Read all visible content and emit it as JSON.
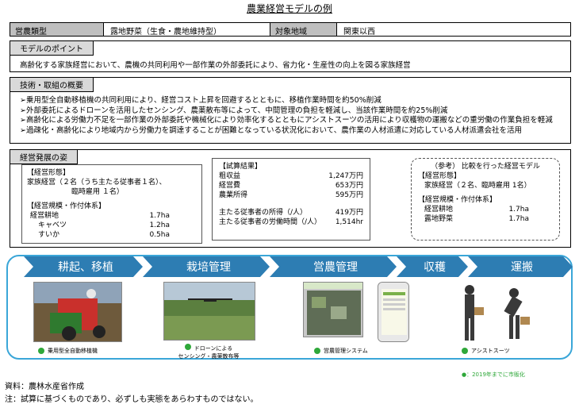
{
  "title": "農業経営モデルの例",
  "header": {
    "type_label": "営農類型",
    "type_value": "露地野菜（生食・農地維持型）",
    "area_label": "対象地域",
    "area_value": "関東以西"
  },
  "point": {
    "label": "モデルのポイント",
    "text": "高齢化する家族経営において、農機の共同利用や一部作業の外部委託により、省力化・生産性の向上を図る家族経営"
  },
  "tech": {
    "label": "技術・取組の概要",
    "items": [
      "➢乗用型全自動移植機の共同利用により、経営コスト上昇を回避するとともに、移植作業時間を約50%削減",
      "➢外部委託によるドローンを活用したセンシング、農薬散布等によって、中間管理の負担を軽減し、当該作業時間を約25%削減",
      "➢高齢化による労働力不足を一部作業の外部委託や機械化により効率化するとともにアシストスーツの活用により収穫物の運搬などの重労働の作業負担を軽減",
      "➢過疎化・高齢化により地域内から労働力を調達することが困難となっている状況化において、農作業の人材派遣に対応している人材派遣会社を活用"
    ]
  },
  "dev": {
    "label": "経営発展の姿",
    "form_header": "【経営形態】",
    "form_line1": "家族経営（２名（うち主たる従事者１名）、",
    "form_line2": "臨時雇用 １名）",
    "scale_header": "【経営規模・作付体系】",
    "scale": [
      {
        "k": "経営耕地",
        "v": "1.7ha"
      },
      {
        "k": "キャベツ",
        "v": "1.2ha"
      },
      {
        "k": "すいか",
        "v": "0.5ha"
      }
    ],
    "calc_header": "【試算結果】",
    "calc": [
      {
        "k": "粗収益",
        "v": "1,247万円"
      },
      {
        "k": "経営費",
        "v": "653万円"
      },
      {
        "k": "農業所得",
        "v": "595万円"
      }
    ],
    "calc2": [
      {
        "k": "主たる従事者の所得（/人）",
        "v": "419万円"
      },
      {
        "k": "主たる従事者の労働時間（/人）",
        "v": "1,514hr"
      }
    ],
    "ref_title": "（参考） 比較を行った経営モデル",
    "ref_form_header": "【経営形態】",
    "ref_form": "家族経営（２名、臨時雇用 1名）",
    "ref_scale_header": "【経営規模・作付体系】",
    "ref_scale": [
      {
        "k": "経営耕地",
        "v": "1.7ha"
      },
      {
        "k": "露地野菜",
        "v": "1.7ha"
      }
    ]
  },
  "flow": {
    "steps": [
      "耕起、移植",
      "栽培管理",
      "営農管理",
      "収穫",
      "運搬"
    ],
    "captions": [
      "乗用型全自動移植機",
      "ドローンによる",
      "センシング・農薬散布等",
      "営農管理システム",
      "アシストスーツ"
    ],
    "accent": "#2d7db3",
    "dot_color": "#2fa83a"
  },
  "legend": "●：2019年までに市販化",
  "notes": [
    "資料：農林水産省作成",
    "注：試算に基づくものであり、必ずしも実態をあらわすものではない。"
  ]
}
